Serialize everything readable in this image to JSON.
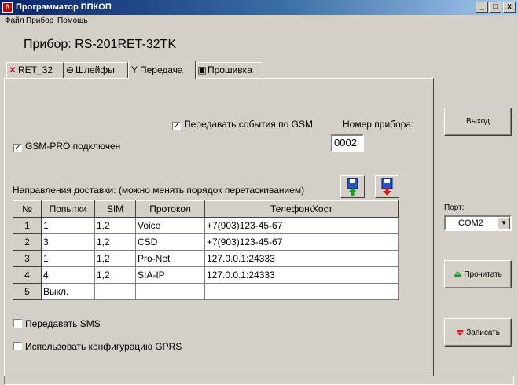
{
  "window": {
    "title": "Программатор ППКОП",
    "minimize": "_",
    "maximize": "□",
    "close": "x"
  },
  "menu": [
    "Файл",
    "Прибор",
    "Помощь"
  ],
  "device": "Прибор: RS-201RET-32TK",
  "tabs": [
    {
      "label": "RET_32",
      "icon": "antenna-icon"
    },
    {
      "label": "Шлейфы",
      "icon": "loop-icon"
    },
    {
      "label": "Передача",
      "icon": "transmit-icon"
    },
    {
      "label": "Прошивка",
      "icon": "firmware-icon"
    }
  ],
  "active_tab": "Передача",
  "panel": {
    "send_gsm": {
      "label": "Передавать события по GSM",
      "checked": true
    },
    "gsm_pro": {
      "label": "GSM-PRO подключен",
      "checked": true
    },
    "device_number_label": "Номер прибора:",
    "device_number": "0002",
    "directions_label": "Направления доставки: (можно менять порядок перетаскиванием)",
    "table": {
      "headers": [
        "№",
        "Попытки",
        "SIM",
        "Протокол",
        "Телефон\\Хост"
      ],
      "rows": [
        [
          "1",
          "1",
          "1,2",
          "Voice",
          "+7(903)123-45-67"
        ],
        [
          "2",
          "3",
          "1,2",
          "CSD",
          "+7(903)123-45-67"
        ],
        [
          "3",
          "1",
          "1,2",
          "Pro-Net",
          "127.0.0.1:24333"
        ],
        [
          "4",
          "4",
          "1,2",
          "SIA-IP",
          "127.0.0.1:24333"
        ],
        [
          "5",
          "Выкл.",
          "",
          "",
          ""
        ]
      ]
    },
    "send_sms": {
      "label": "Передавать SMS",
      "checked": false
    },
    "use_gprs": {
      "label": "Использовать конфигурацию GPRS",
      "checked": false
    }
  },
  "side": {
    "exit": "Выход",
    "port_label": "Порт:",
    "port_value": "COM2",
    "read": "Прочитать",
    "write": "Записать"
  }
}
